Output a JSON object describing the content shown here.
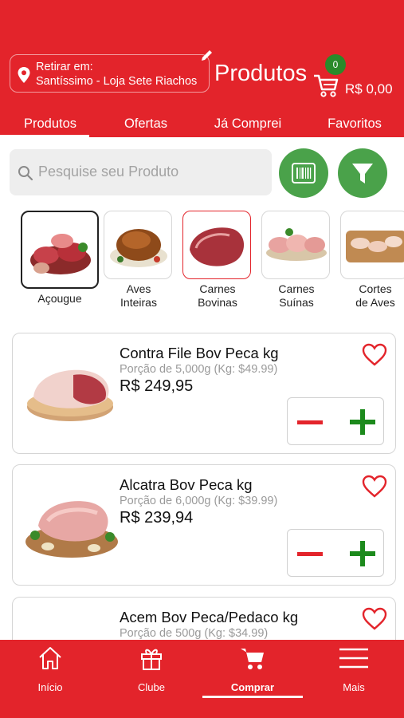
{
  "header": {
    "pickup_label": "Retirar em:",
    "pickup_store": "Santíssimo - Loja Sete Riachos",
    "title": "Produtos",
    "cart_count": "0",
    "cart_total": "R$ 0,00"
  },
  "tabs": [
    {
      "label": "Produtos"
    },
    {
      "label": "Ofertas"
    },
    {
      "label": "Já Comprei"
    },
    {
      "label": "Favoritos"
    }
  ],
  "search": {
    "placeholder": "Pesquise seu Produto"
  },
  "categories": [
    {
      "label": "Açougue"
    },
    {
      "label": "Aves\nInteiras"
    },
    {
      "label": "Carnes\nBovinas"
    },
    {
      "label": "Carnes\nSuínas"
    },
    {
      "label": "Cortes\nde Aves"
    }
  ],
  "products": [
    {
      "name": "Contra File Bov Peca kg",
      "portion": "Porção de 5,000g (Kg: $49.99)",
      "price": "R$ 249,95"
    },
    {
      "name": "Alcatra Bov Peca kg",
      "portion": "Porção de 6,000g (Kg: $39.99)",
      "price": "R$ 239,94"
    },
    {
      "name": "Acem Bov Peca/Pedaco kg",
      "portion": "Porção de 500g (Kg: $34.99)",
      "price": ""
    }
  ],
  "bottom_nav": [
    {
      "label": "Início",
      "icon": "home-icon"
    },
    {
      "label": "Clube",
      "icon": "gift-icon"
    },
    {
      "label": "Comprar",
      "icon": "cart-icon"
    },
    {
      "label": "Mais",
      "icon": "menu-icon"
    }
  ],
  "colors": {
    "brand": "#e3242b",
    "accent_green": "#4aa24a",
    "plus_green": "#1c8a1c",
    "active_border": "#e3242b"
  }
}
